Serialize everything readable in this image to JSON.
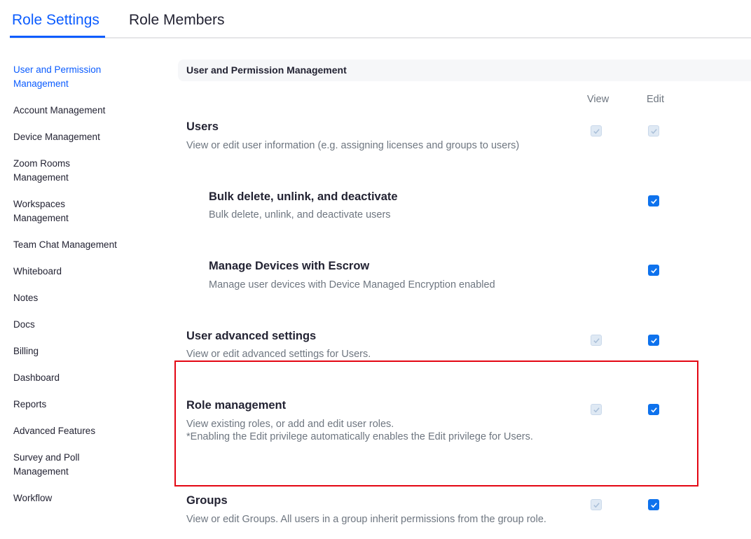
{
  "tabs": {
    "role_settings": "Role Settings",
    "role_members": "Role Members"
  },
  "sidebar": {
    "items": [
      "User and Permission Management",
      "Account Management",
      "Device Management",
      "Zoom Rooms Management",
      "Workspaces Management",
      "Team Chat Management",
      "Whiteboard",
      "Notes",
      "Docs",
      "Billing",
      "Dashboard",
      "Reports",
      "Advanced Features",
      "Survey and Poll Management",
      "Workflow"
    ],
    "active_index": 0
  },
  "section": {
    "title": "User and Permission Management",
    "col_view": "View",
    "col_edit": "Edit"
  },
  "permissions": {
    "users": {
      "title": "Users",
      "desc": "View or edit user information (e.g. assigning licenses and groups to users)",
      "view": "checked-disabled",
      "edit": "checked-disabled"
    },
    "bulk": {
      "title": "Bulk delete, unlink, and deactivate",
      "desc": "Bulk delete, unlink, and deactivate users",
      "edit": "checked"
    },
    "escrow": {
      "title": "Manage Devices with Escrow",
      "desc": "Manage user devices with Device Managed Encryption enabled",
      "edit": "checked"
    },
    "advanced": {
      "title": "User advanced settings",
      "desc": "View or edit advanced settings for Users.",
      "view": "checked-disabled",
      "edit": "checked"
    },
    "role_mgmt": {
      "title": "Role management",
      "desc_line1": "View existing roles, or add and edit user roles.",
      "desc_line2": "*Enabling the Edit privilege automatically enables the Edit privilege for Users.",
      "view": "checked-disabled",
      "edit": "checked"
    },
    "groups": {
      "title": "Groups",
      "desc": "View or edit Groups. All users in a group inherit permissions from the group role.",
      "view": "checked-disabled",
      "edit": "checked"
    }
  },
  "colors": {
    "accent": "#0b5cff",
    "checkbox": "#0e72ed",
    "highlight": "#e30613"
  }
}
